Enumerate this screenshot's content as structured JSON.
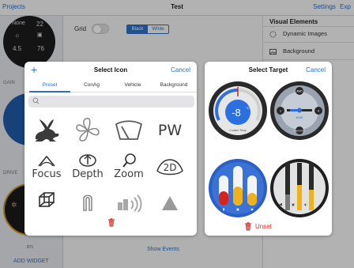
{
  "topbar": {
    "left_link": "Projects",
    "title": "Test",
    "settings": "Settings",
    "export": "Exp"
  },
  "left": {
    "watch1": {
      "top_label": "None",
      "top_value": "22",
      "mid_values": [
        "4.5",
        "76"
      ]
    },
    "label_2": "GAIN",
    "label_3": "DRIVE",
    "watch3_value": "871",
    "add_widget": "ADD WIDGET"
  },
  "center": {
    "grid_label": "Grid",
    "grid_enabled": false,
    "segments": [
      "Black",
      "White"
    ],
    "selected_segment": "Black",
    "show_events": "Show Events"
  },
  "right": {
    "header": "Visual Elements",
    "items": [
      {
        "label": "Dynamic Images",
        "icon": "dashed-circle-icon"
      },
      {
        "label": "Background",
        "icon": "image-icon"
      }
    ],
    "toggle_green_on": true
  },
  "select_icon": {
    "add_icon": "+",
    "title": "Select Icon",
    "cancel": "Cancel",
    "tabs": [
      "Preset",
      "ConAg",
      "Vehicle",
      "Background"
    ],
    "active_tab": "Preset",
    "search_placeholder": "",
    "icons": [
      {
        "name": "rabbit-icon"
      },
      {
        "name": "fan-icon"
      },
      {
        "name": "wiper-icon"
      },
      {
        "name": "pw-icon",
        "text": "PW"
      },
      {
        "name": "focus-icon",
        "text": "Focus"
      },
      {
        "name": "depth-icon",
        "text": "Depth"
      },
      {
        "name": "zoom-icon",
        "text": "Zoom"
      },
      {
        "name": "2d-icon",
        "text": "2D"
      },
      {
        "name": "cube-icon"
      },
      {
        "name": "magnet-icon"
      },
      {
        "name": "signal-icon"
      },
      {
        "name": "triangle-icon"
      }
    ],
    "delete_icon": "trash-icon"
  },
  "select_target": {
    "title": "Select Target",
    "cancel": "Cancel",
    "gauge1": {
      "value": "-8",
      "unit": "°C",
      "caption": "Coolant Temp"
    },
    "gauge2": {
      "top": "AWD",
      "left": "1",
      "right": "4",
      "bottom": "AWD RATIO",
      "mid": "50/50"
    },
    "unset": "Unset"
  },
  "colors": {
    "accent": "#2f6fc4",
    "danger": "#d6322b",
    "gauge_dark": "#2a2a2a",
    "gauge_blue": "#2b6fe0",
    "bar_red": "#d4241c",
    "bar_yellow": "#f0b21a"
  }
}
